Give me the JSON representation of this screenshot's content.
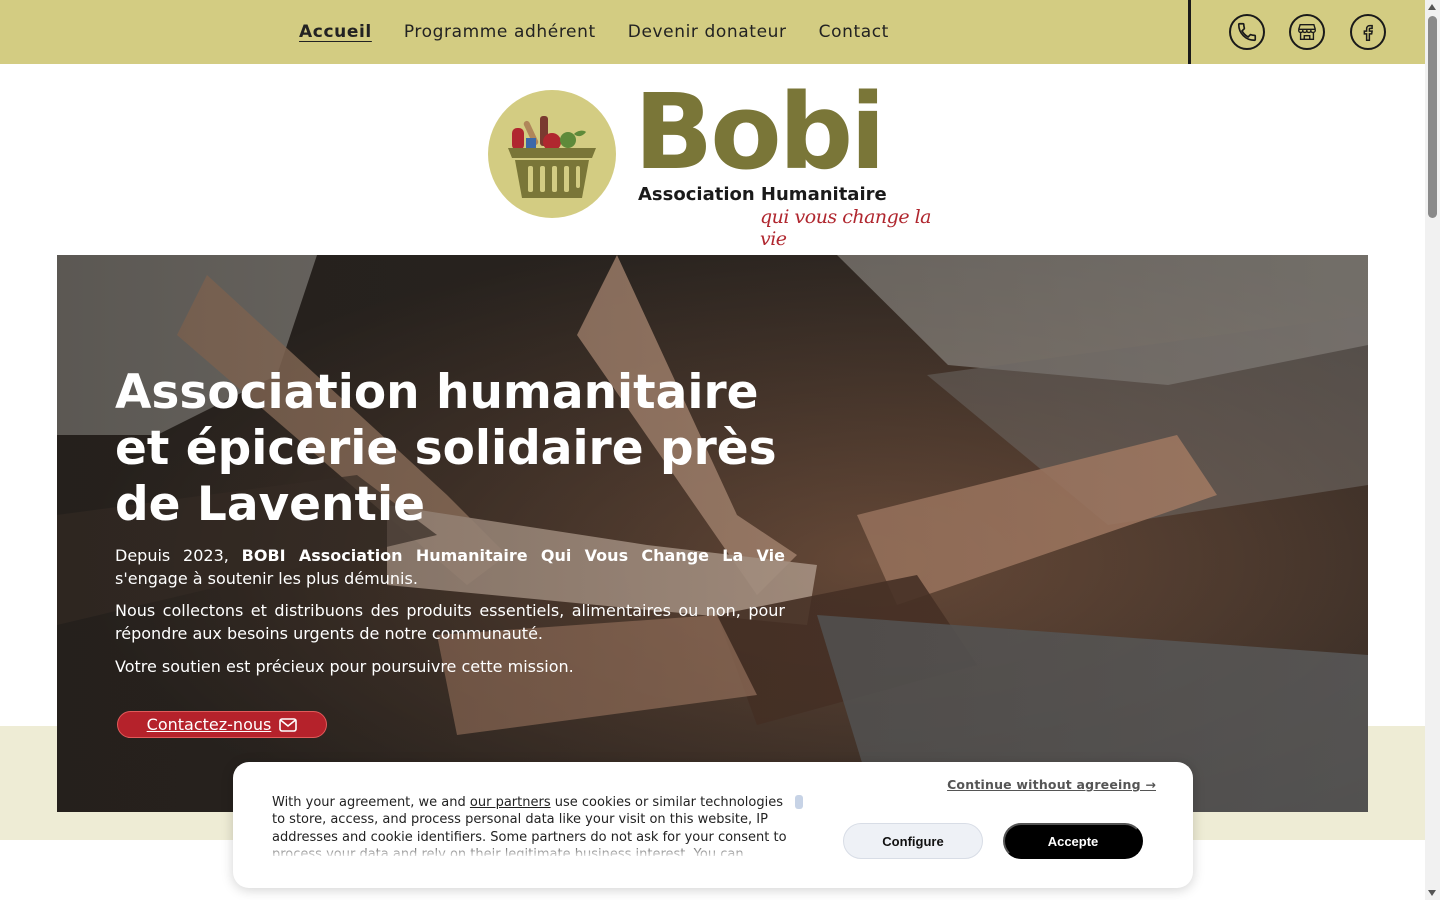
{
  "nav": {
    "items": [
      {
        "label": "Accueil",
        "active": true
      },
      {
        "label": "Programme adhérent",
        "active": false
      },
      {
        "label": "Devenir donateur",
        "active": false
      },
      {
        "label": "Contact",
        "active": false
      }
    ],
    "icons": [
      "phone-icon",
      "store-icon",
      "facebook-icon"
    ]
  },
  "logo": {
    "word": "Bobi",
    "subtitle": "Association Humanitaire",
    "tagline": "qui vous change la vie"
  },
  "hero": {
    "title": "Association humanitaire et épicerie solidaire près de Laventie",
    "p1_prefix": "Depuis 2023,",
    "p1_bold": "BOBI Association Humanitaire Qui Vous Change La Vie",
    "p1_suffix": "s'engage à soutenir les plus démunis.",
    "p2": "Nous collectons et distribuons des produits essentiels, alimentaires ou non, pour répondre aux besoins urgents de notre communauté.",
    "p3": "Votre soutien est précieux pour poursuivre cette mission.",
    "cta_label": "Contactez-nous"
  },
  "cookie": {
    "text_prefix": "With your agreement, we and",
    "partners_link": "our partners",
    "text_suffix": "use cookies or similar technologies to store, access, and process personal data like your visit on this website, IP addresses and cookie identifiers. Some partners do not ask for your consent to process your data and rely on their legitimate business interest. You can",
    "continue_label": "Continue without agreeing →",
    "configure_label": "Configure",
    "accept_label": "Accepte"
  },
  "colors": {
    "topbar": "#d3cc82",
    "brand_olive": "#7a7638",
    "brand_red": "#b5222b",
    "band": "#eeecd5"
  }
}
